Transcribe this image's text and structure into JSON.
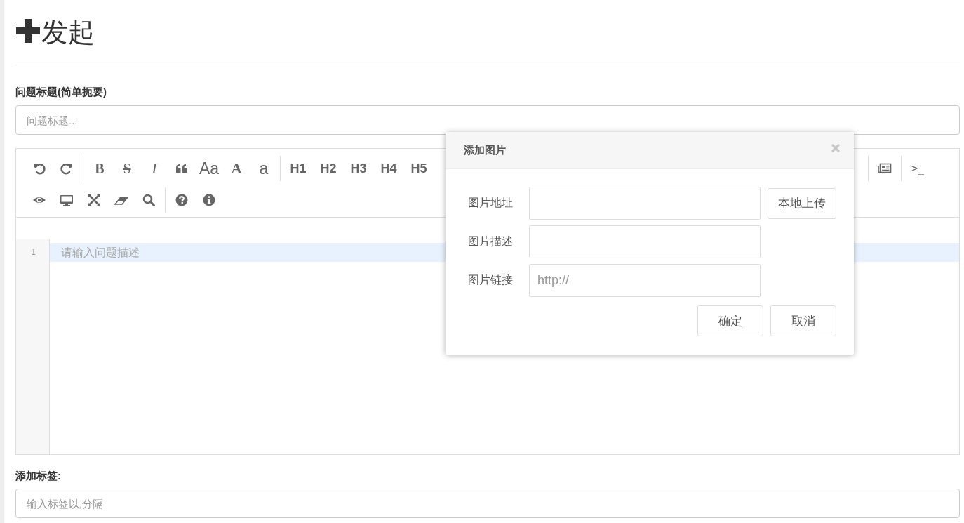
{
  "page": {
    "title": "发起"
  },
  "question_title": {
    "label": "问题标题(简单扼要)",
    "placeholder": "问题标题..."
  },
  "editor": {
    "toolbar": {
      "rows": [
        {
          "groups": [
            {
              "items": [
                {
                  "kind": "icon"
                },
                {
                  "kind": "icon"
                }
              ]
            },
            {
              "items": [
                {
                  "kind": "bold",
                  "label": "B"
                },
                {
                  "kind": "strike",
                  "label": "S"
                },
                {
                  "kind": "italic",
                  "label": "I"
                },
                {
                  "kind": "icon"
                },
                {
                  "kind": "plain",
                  "label": "Aa"
                },
                {
                  "kind": "serif",
                  "label": "A"
                },
                {
                  "kind": "plain",
                  "label": "a"
                }
              ]
            },
            {
              "items": [
                {
                  "kind": "heading",
                  "label": "H1"
                },
                {
                  "kind": "heading",
                  "label": "H2"
                },
                {
                  "kind": "heading",
                  "label": "H3"
                },
                {
                  "kind": "heading",
                  "label": "H4"
                },
                {
                  "kind": "heading",
                  "label": "H5"
                }
              ]
            }
          ],
          "end_groups": [
            {
              "items": [
                {
                  "kind": "icon"
                }
              ]
            },
            {
              "items": [
                {
                  "kind": "mono",
                  "label": ">_"
                }
              ]
            }
          ]
        },
        {
          "groups": [
            {
              "items": [
                {
                  "kind": "icon"
                },
                {
                  "kind": "icon"
                },
                {
                  "kind": "icon"
                },
                {
                  "kind": "icon"
                },
                {
                  "kind": "icon"
                }
              ]
            },
            {
              "items": [
                {
                  "kind": "icon"
                },
                {
                  "kind": "icon"
                }
              ]
            }
          ]
        }
      ]
    },
    "lines": [
      {
        "number": "1",
        "placeholder": "请输入问题描述",
        "active": true
      }
    ]
  },
  "tags": {
    "label": "添加标签:",
    "placeholder": "输入标签以,分隔"
  },
  "dialog": {
    "title": "添加图片",
    "fields": [
      {
        "label": "图片地址"
      },
      {
        "label": "图片描述"
      },
      {
        "label": "图片链接",
        "value": "http://"
      }
    ],
    "upload_button": "本地上传",
    "buttons": [
      "确定",
      "取消"
    ]
  }
}
